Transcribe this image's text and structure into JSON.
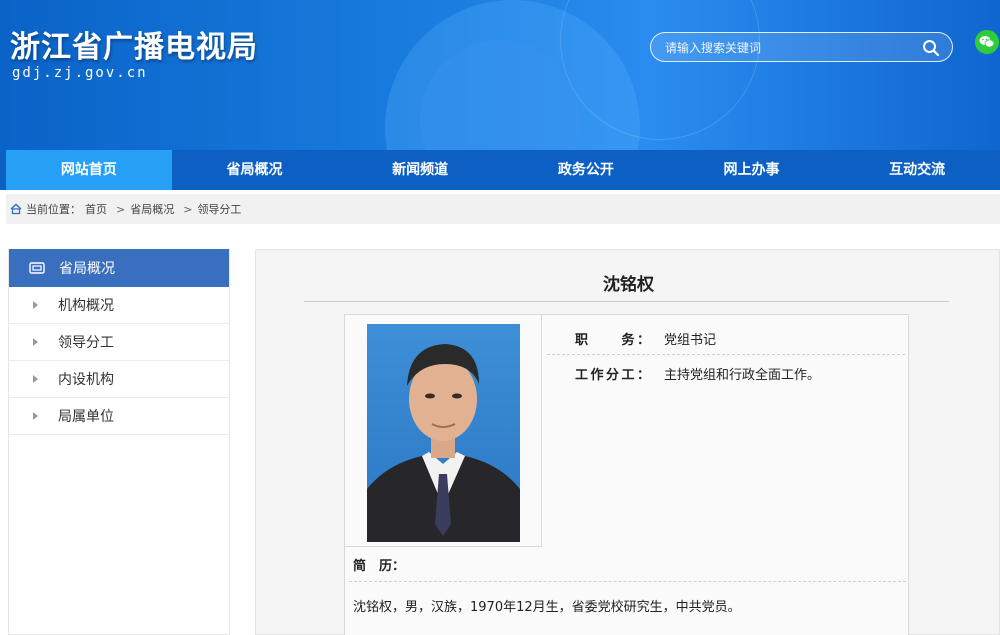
{
  "header": {
    "site_title": "浙江省广播电视局",
    "site_domain": "gdj.zj.gov.cn",
    "search_placeholder": "请输入搜索关键词",
    "brand_color": "#0c60c4"
  },
  "nav": {
    "items": [
      {
        "label": "网站首页",
        "active": true
      },
      {
        "label": "省局概况"
      },
      {
        "label": "新闻频道"
      },
      {
        "label": "政务公开"
      },
      {
        "label": "网上办事"
      },
      {
        "label": "互动交流"
      }
    ]
  },
  "breadcrumb": {
    "prefix": "当前位置：",
    "items": [
      "首页",
      "省局概况",
      "领导分工"
    ],
    "separator": ">"
  },
  "sidebar": {
    "header": "省局概况",
    "items": [
      "机构概况",
      "领导分工",
      "内设机构",
      "局属单位"
    ]
  },
  "profile": {
    "name": "沈铭权",
    "position_label": "职　　务：",
    "position_value": "党组书记",
    "duty_label": "工作分工：",
    "duty_value": "主持党组和行政全面工作。",
    "bio_label": "简　历：",
    "bio_text": "沈铭权，男，汉族，1970年12月生，省委党校研究生，中共党员。"
  }
}
